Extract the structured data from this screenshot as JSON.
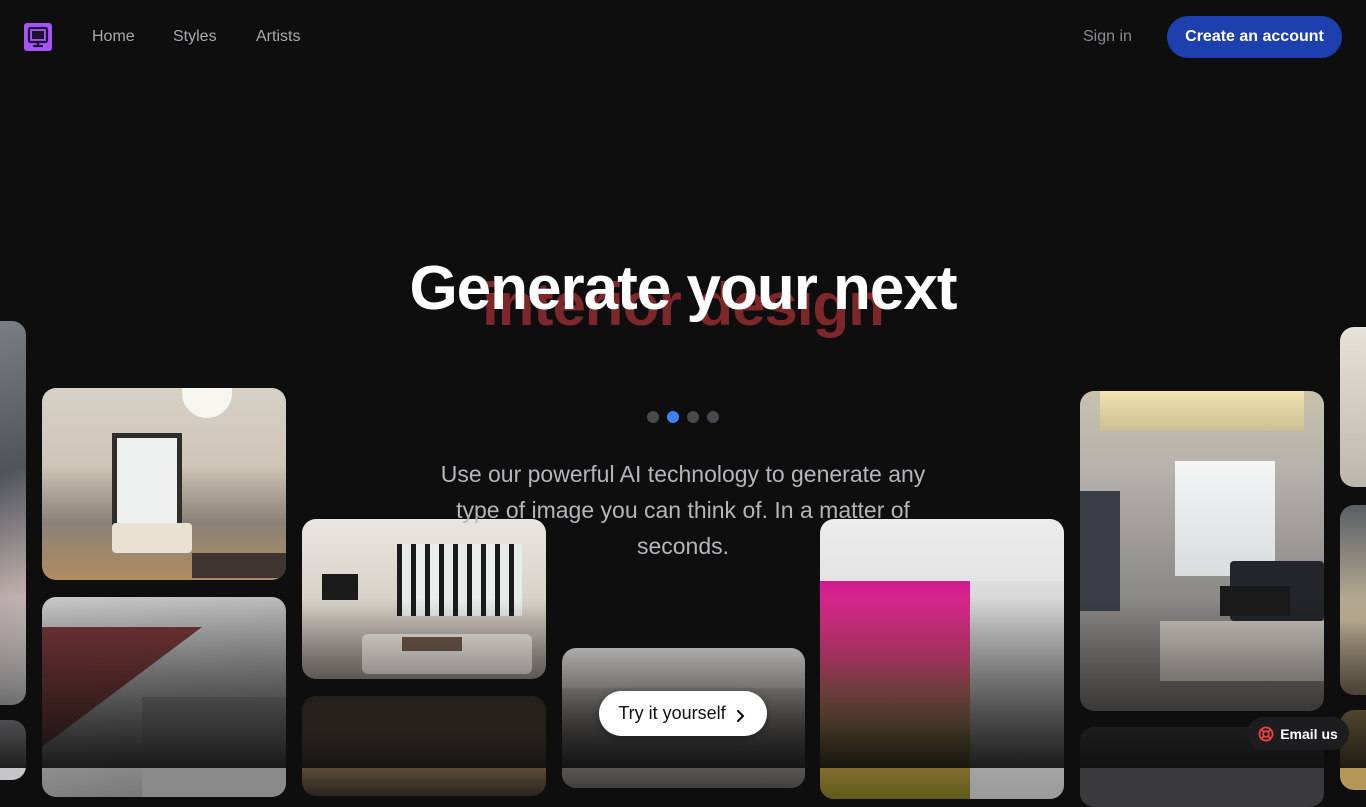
{
  "nav": {
    "links": [
      "Home",
      "Styles",
      "Artists"
    ],
    "sign_in": "Sign in",
    "create_account": "Create an account"
  },
  "hero": {
    "title": "Generate your next",
    "rotating_word": "interior design",
    "description": "Use our powerful AI technology to generate any type of image you can think of. In a matter of seconds.",
    "cta": "Try it yourself",
    "carousel_active_index": 1,
    "carousel_count": 4
  },
  "support": {
    "label": "Email us"
  },
  "colors": {
    "background": "#0e0e0f",
    "primary_button": "#1e40af",
    "logo": "#a855f7",
    "active_dot": "#3b82f6"
  },
  "icons": [
    "logo-icon",
    "chevron-right-icon",
    "lifebuoy-icon"
  ]
}
